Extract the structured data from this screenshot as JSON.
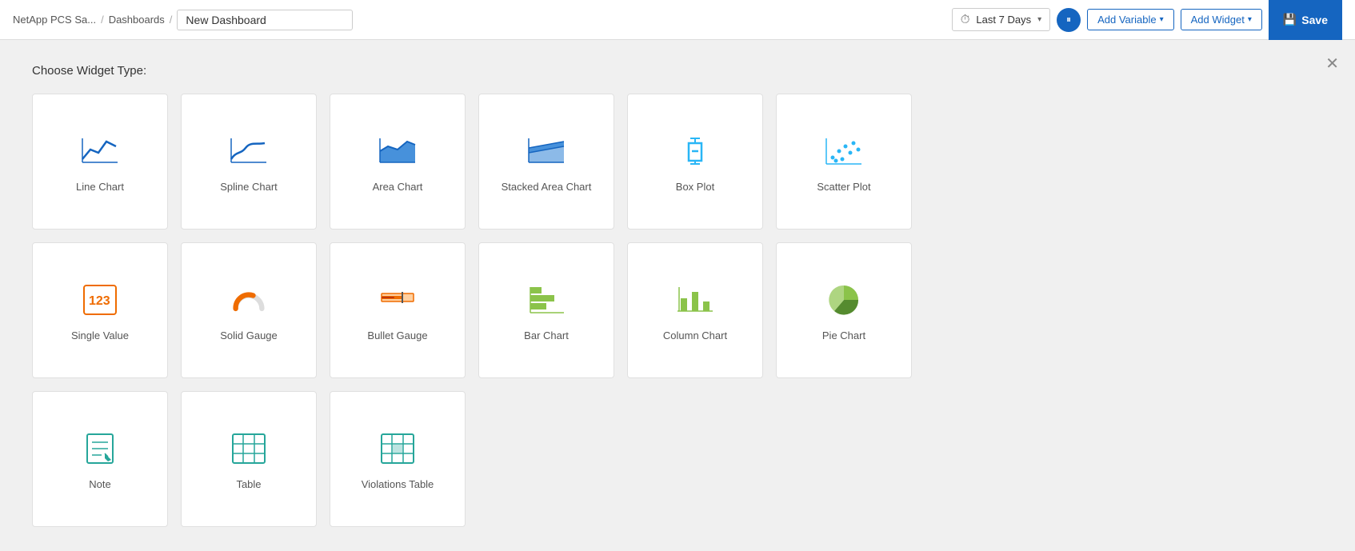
{
  "header": {
    "app_name": "NetApp PCS Sa...",
    "sep1": "/",
    "dashboards_label": "Dashboards",
    "sep2": "/",
    "dashboard_name": "New Dashboard",
    "time_label": "Last 7 Days",
    "add_variable_label": "Add Variable",
    "add_widget_label": "Add Widget",
    "save_label": "Save"
  },
  "content": {
    "choose_title": "Choose Widget Type:",
    "widgets": [
      [
        {
          "id": "line-chart",
          "label": "Line Chart",
          "icon": "line",
          "color": "#1565c0"
        },
        {
          "id": "spline-chart",
          "label": "Spline Chart",
          "icon": "spline",
          "color": "#1565c0"
        },
        {
          "id": "area-chart",
          "label": "Area Chart",
          "icon": "area",
          "color": "#1976d2"
        },
        {
          "id": "stacked-area-chart",
          "label": "Stacked Area Chart",
          "icon": "stacked-area",
          "color": "#1976d2"
        },
        {
          "id": "box-plot",
          "label": "Box Plot",
          "icon": "box-plot",
          "color": "#29b6f6"
        },
        {
          "id": "scatter-plot",
          "label": "Scatter Plot",
          "icon": "scatter",
          "color": "#29b6f6"
        }
      ],
      [
        {
          "id": "single-value",
          "label": "Single Value",
          "icon": "single-value",
          "color": "#ef6c00"
        },
        {
          "id": "solid-gauge",
          "label": "Solid Gauge",
          "icon": "solid-gauge",
          "color": "#ef6c00"
        },
        {
          "id": "bullet-gauge",
          "label": "Bullet Gauge",
          "icon": "bullet-gauge",
          "color": "#ef6c00"
        },
        {
          "id": "bar-chart",
          "label": "Bar Chart",
          "icon": "bar",
          "color": "#8bc34a"
        },
        {
          "id": "column-chart",
          "label": "Column Chart",
          "icon": "column",
          "color": "#8bc34a"
        },
        {
          "id": "pie-chart",
          "label": "Pie Chart",
          "icon": "pie",
          "color": "#8bc34a"
        }
      ],
      [
        {
          "id": "note",
          "label": "Note",
          "icon": "note",
          "color": "#26a69a"
        },
        {
          "id": "table",
          "label": "Table",
          "icon": "table",
          "color": "#26a69a"
        },
        {
          "id": "violations-table",
          "label": "Violations Table",
          "icon": "violations-table",
          "color": "#26a69a"
        }
      ]
    ]
  }
}
